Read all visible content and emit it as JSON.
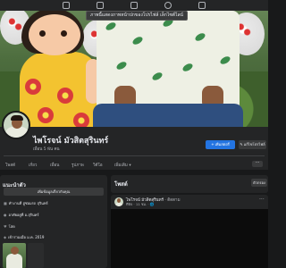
{
  "nav": {
    "icons": [
      "home-icon",
      "video-icon",
      "marketplace-icon",
      "groups-icon",
      "gaming-icon"
    ]
  },
  "cover": {
    "tooltip_text": "ภาพนี้แสดงภาพหน้าปกของโปรไฟล์ เล็กไซต์ไลน์"
  },
  "profile": {
    "name": "ไพโรจน์ มัวสิตสุรินทร์",
    "friends_text": "เพื่อน 5 พัน คน",
    "primary_button": "เพิ่มสตอรี่",
    "secondary_button": "แก้ไขโปรไฟล์"
  },
  "tabs": [
    "โพสต์",
    "เกี่ยว",
    "เพื่อน",
    "รูปภาพ",
    "วิดีโอ",
    "อื่นๆ",
    "เพิ่มเติม ▾"
  ],
  "tabs_more": "···",
  "intro": {
    "title": "แนะนำตัว",
    "edit_button": "เพิ่มข้อมูลเกี่ยวกับคุณ",
    "lines": [
      {
        "icon": "■",
        "text": "ทำงานที่ อู่ซ่อมรถ สุรินทร์"
      },
      {
        "icon": "●",
        "text": "อาศัยอยู่ที่ อ.สุรินทร์"
      },
      {
        "icon": "♥",
        "text": "โสด"
      },
      {
        "icon": "◆",
        "text": "เข้าร่วมเมื่อ ม.ค. 2019"
      }
    ]
  },
  "posts": {
    "title": "โพสต์",
    "filter_button": "ตัวกรอง",
    "item": {
      "author": "ไพโรจน์ มัวสิตสุรินทร์",
      "action": " · ติดตาม",
      "meta": "ทีพิจ · 11 ชม. · 🌐",
      "more": "···"
    }
  }
}
